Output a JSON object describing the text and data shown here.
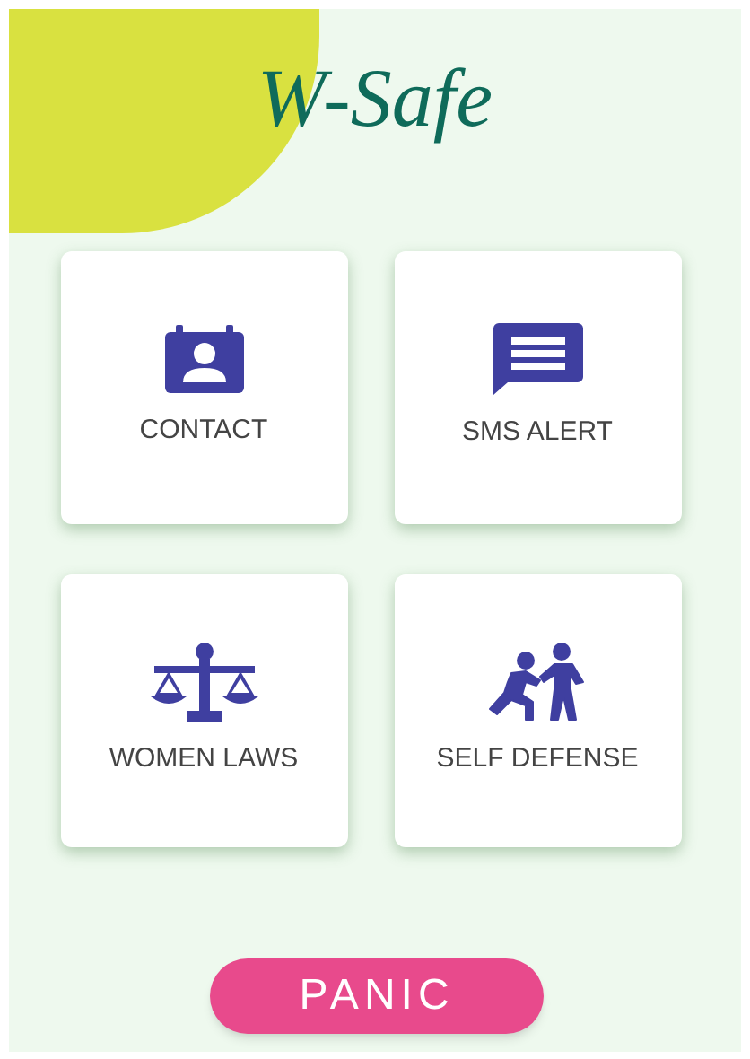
{
  "app": {
    "title": "W-Safe"
  },
  "tiles": [
    {
      "label": "CONTACT",
      "kind": "contact"
    },
    {
      "label": "SMS ALERT",
      "kind": "message"
    },
    {
      "label": "WOMEN LAWS",
      "kind": "scales"
    },
    {
      "label": "SELF DEFENSE",
      "kind": "figures"
    }
  ],
  "panic_button": {
    "label": "PANIC"
  }
}
